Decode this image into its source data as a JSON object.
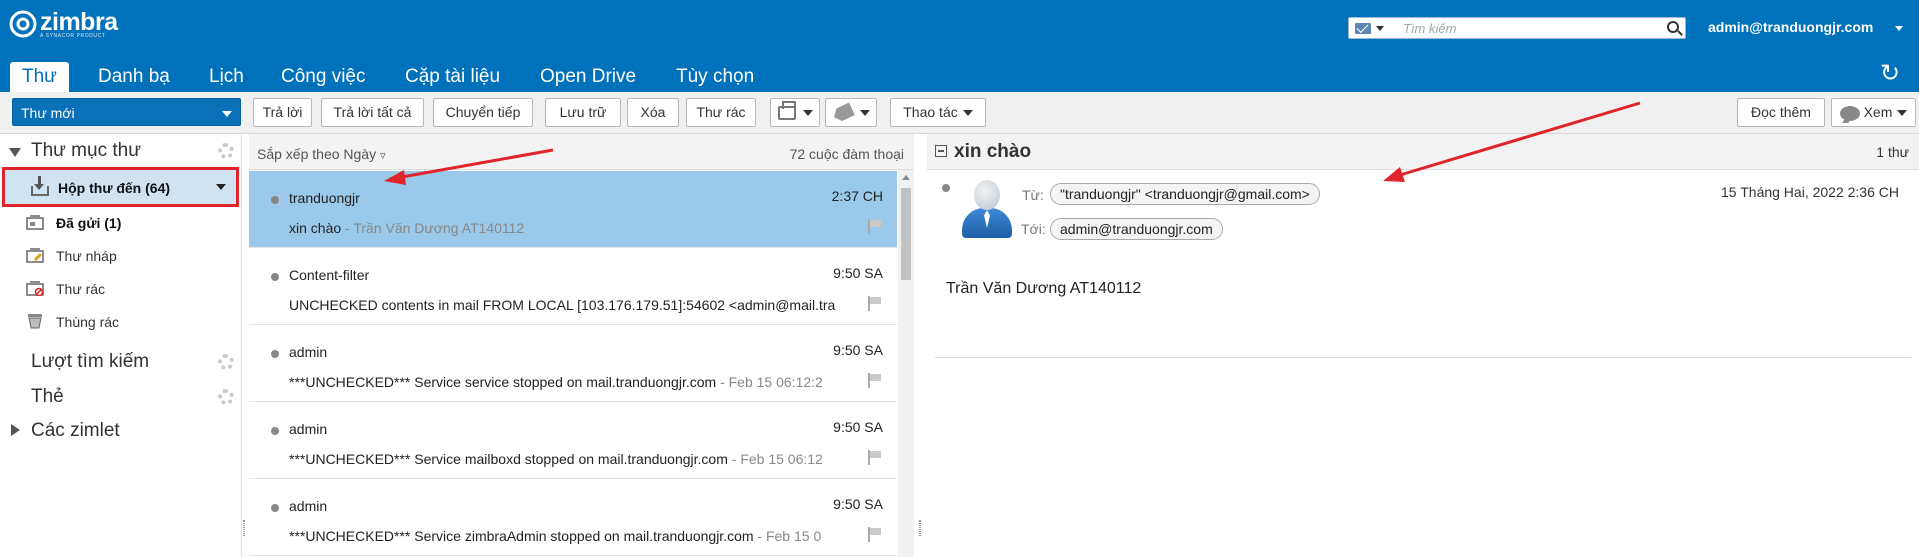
{
  "header": {
    "logo_name": "zimbra",
    "logo_sub": "A SYNACOR PRODUCT",
    "search_placeholder": "Tìm kiếm",
    "user": "admin@tranduongjr.com"
  },
  "tabs": [
    "Thư",
    "Danh bạ",
    "Lịch",
    "Công việc",
    "Cặp tài liệu",
    "Open Drive",
    "Tùy chọn"
  ],
  "toolbar": {
    "new_mail": "Thư mới",
    "reply": "Trả lời",
    "reply_all": "Trả lời tất cả",
    "forward": "Chuyển tiếp",
    "archive": "Lưu trữ",
    "delete": "Xóa",
    "spam": "Thư rác",
    "actions": "Thao tác",
    "read_more": "Đọc thêm",
    "view": "Xem"
  },
  "sidebar": {
    "mail_folders": "Thư mục thư",
    "folders": [
      {
        "label": "Hộp thư đến (64)",
        "icon": "inbox-icon"
      },
      {
        "label": "Đã gửi (1)",
        "icon": "sent-icon"
      },
      {
        "label": "Thư nháp",
        "icon": "drafts-icon"
      },
      {
        "label": "Thư rác",
        "icon": "junk-icon"
      },
      {
        "label": "Thùng rác",
        "icon": "trash-icon"
      }
    ],
    "searches": "Lượt tìm kiếm",
    "tags": "Thẻ",
    "zimlets": "Các zimlet"
  },
  "list": {
    "sort": "Sắp xếp theo Ngày",
    "count": "72 cuộc đàm thoại",
    "messages": [
      {
        "from": "tranduongjr",
        "time": "2:37 CH",
        "subject": "xin chào",
        "fragment": " - Trần Văn Dương AT140112"
      },
      {
        "from": "Content-filter",
        "time": "9:50 SA",
        "subject": "UNCHECKED contents in mail FROM LOCAL [103.176.179.51]:54602 <admin@mail.tra",
        "fragment": ""
      },
      {
        "from": "admin",
        "time": "9:50 SA",
        "subject": "***UNCHECKED*** Service service stopped on mail.tranduongjr.com",
        "fragment": " - Feb 15 06:12:2"
      },
      {
        "from": "admin",
        "time": "9:50 SA",
        "subject": "***UNCHECKED*** Service mailboxd stopped on mail.tranduongjr.com",
        "fragment": " - Feb 15 06:12"
      },
      {
        "from": "admin",
        "time": "9:50 SA",
        "subject": "***UNCHECKED*** Service zimbraAdmin stopped on mail.tranduongjr.com",
        "fragment": " - Feb 15 0"
      }
    ]
  },
  "reading": {
    "subject": "xin chào",
    "count": "1 thư",
    "from_label": "Từ:",
    "from": "\"tranduongjr\" <tranduongjr@gmail.com>",
    "to_label": "Tới:",
    "to": "admin@tranduongjr.com",
    "date": "15 Tháng Hai, 2022 2:36 CH",
    "body": "Trần Văn Dương AT140112"
  },
  "colors": {
    "brand": "#0071bb",
    "selection": "#9ac9ea",
    "annotation": "#e0242b"
  }
}
